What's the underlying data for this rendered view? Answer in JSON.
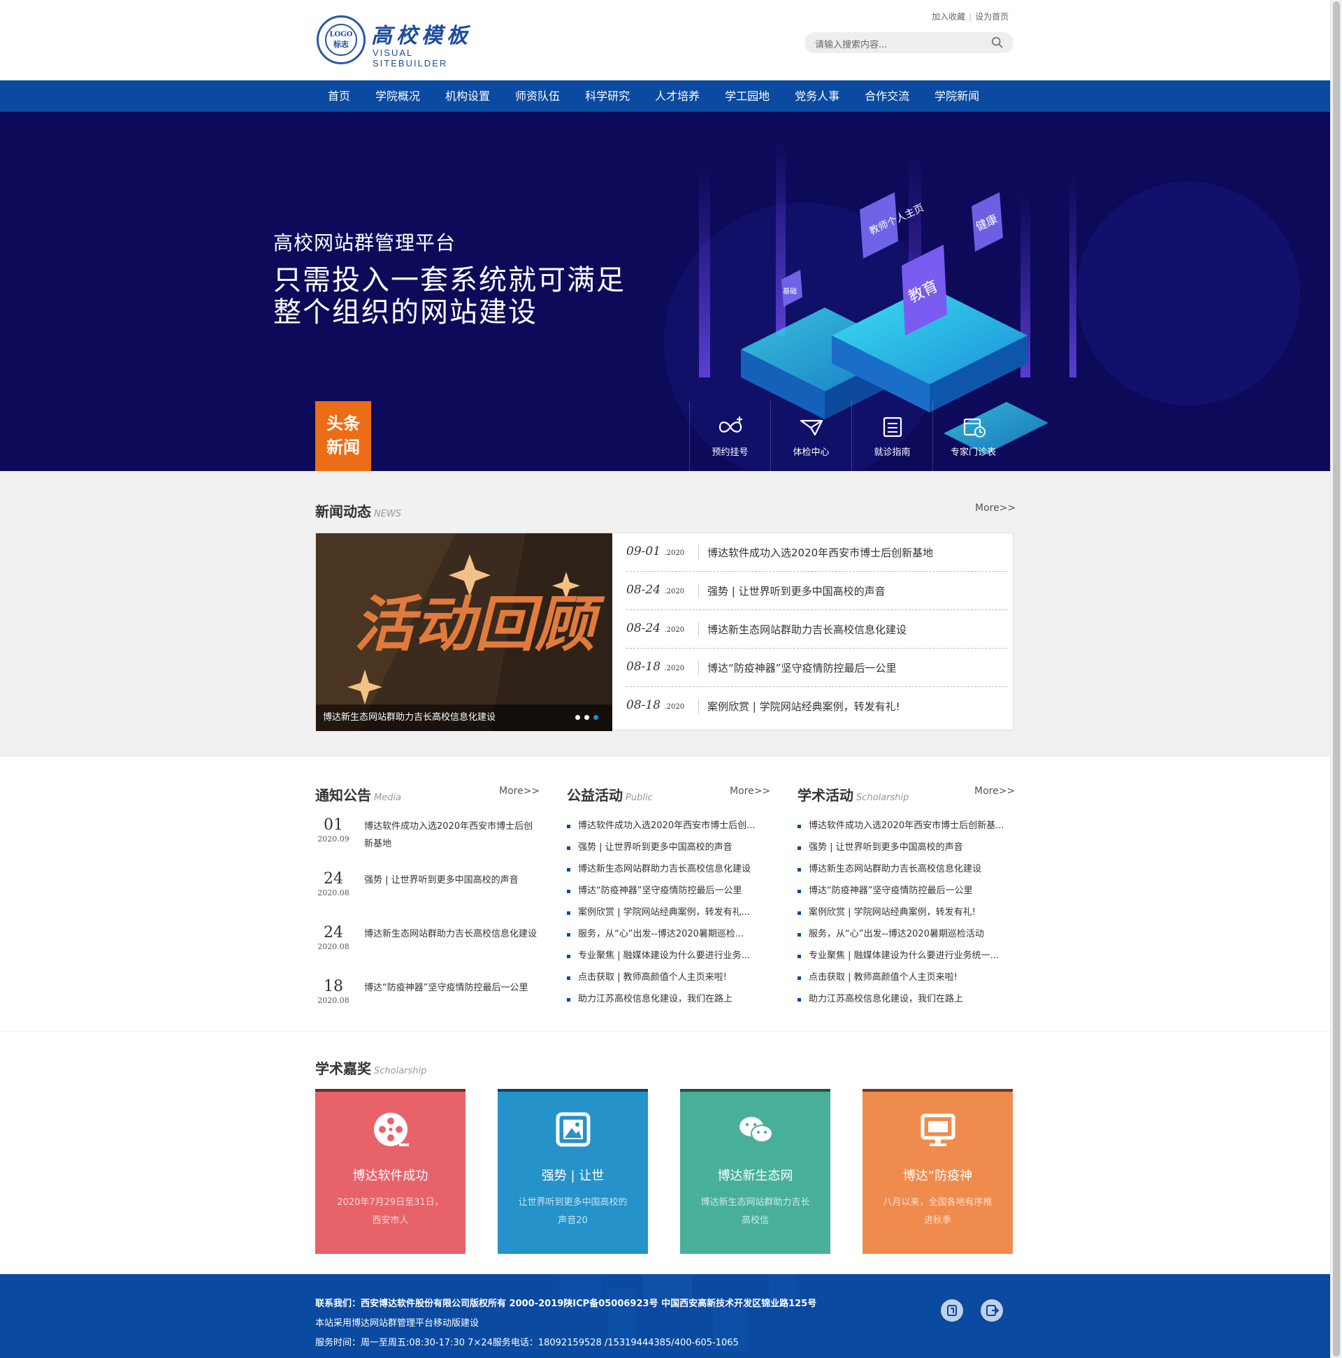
{
  "header": {
    "logo_text": "LOGO",
    "logo_sub_cn": "标志",
    "site_title": "高校模板",
    "site_subtitle": "VISUAL  SITEBUILDER",
    "toplinks": [
      "加入收藏",
      "设为首页"
    ],
    "search_placeholder": "请输入搜索内容..."
  },
  "nav": [
    "首页",
    "学院概况",
    "机构设置",
    "师资队伍",
    "科学研究",
    "人才培养",
    "学工园地",
    "党务人事",
    "合作交流",
    "学院新闻"
  ],
  "banner": {
    "title": "高校网站群管理平台",
    "headline_line1": "只需投入一套系统就可满足",
    "headline_line2": "整个组织的网站建设",
    "badge_line1": "头条",
    "badge_line2": "新闻",
    "quick_links": [
      "预约挂号",
      "体检中心",
      "就诊指南",
      "专家门诊表"
    ],
    "iso_labels": [
      "教师个人主页",
      "教育",
      "健康",
      "基础"
    ],
    "colors": {
      "bg": "#0e0a5a",
      "badge": "#ec6d15"
    }
  },
  "news": {
    "title": "新闻动态",
    "title_en": "NEWS",
    "more": "More>>",
    "image_caption": "博达新生态网站群助力吉长高校信息化建设",
    "image_text": "活动回顾",
    "items": [
      {
        "date": "09-01",
        "year": ".2020",
        "title": "博达软件成功入选2020年西安市博士后创新基地"
      },
      {
        "date": "08-24",
        "year": ".2020",
        "title": "强势 | 让世界听到更多中国高校的声音"
      },
      {
        "date": "08-24",
        "year": ".2020",
        "title": "博达新生态网站群助力吉长高校信息化建设"
      },
      {
        "date": "08-18",
        "year": ".2020",
        "title": "博达“防疫神器”坚守疫情防控最后一公里"
      },
      {
        "date": "08-18",
        "year": ".2020",
        "title": "案例欣赏 | 学院网站经典案例，转发有礼!"
      }
    ]
  },
  "notice": {
    "title": "通知公告",
    "title_en": "Media",
    "more": "More>>",
    "items": [
      {
        "day": "01",
        "ym": "2020.09",
        "title": "博达软件成功入选2020年西安市博士后创新基地"
      },
      {
        "day": "24",
        "ym": "2020.08",
        "title": "强势 | 让世界听到更多中国高校的声音"
      },
      {
        "day": "24",
        "ym": "2020.08",
        "title": "博达新生态网站群助力吉长高校信息化建设"
      },
      {
        "day": "18",
        "ym": "2020.08",
        "title": "博达“防疫神器”坚守疫情防控最后一公里"
      }
    ]
  },
  "public": {
    "title": "公益活动",
    "title_en": "Public",
    "more": "More>>",
    "items": [
      "博达软件成功入选2020年西安市博士后创...",
      "强势 | 让世界听到更多中国高校的声音",
      "博达新生态网站群助力吉长高校信息化建设",
      "博达“防疫神器”坚守疫情防控最后一公里",
      "案例欣赏 | 学院网站经典案例，转发有礼...",
      "服务，从“心”出发--博达2020暑期巡检...",
      "专业聚焦 | 融媒体建设为什么要进行业务...",
      "点击获取 | 教师高颜值个人主页来啦!",
      "助力江苏高校信息化建设，我们在路上"
    ]
  },
  "academic": {
    "title": "学术活动",
    "title_en": "Scholarship",
    "more": "More>>",
    "items": [
      "博达软件成功入选2020年西安市博士后创新基...",
      "强势 | 让世界听到更多中国高校的声音",
      "博达新生态网站群助力吉长高校信息化建设",
      "博达“防疫神器”坚守疫情防控最后一公里",
      "案例欣赏 | 学院网站经典案例，转发有礼!",
      "服务，从“心”出发--博达2020暑期巡检活动",
      "专业聚焦 | 融媒体建设为什么要进行业务统一...",
      "点击获取 | 教师高颜值个人主页来啦!",
      "助力江苏高校信息化建设，我们在路上"
    ]
  },
  "awards": {
    "title": "学术嘉奖",
    "title_en": "Scholarship",
    "cards": [
      {
        "icon": "film-reel-icon",
        "color": "#e8626a",
        "title": "博达软件成功",
        "desc": "2020年7月29日至31日，西安市人"
      },
      {
        "icon": "image-icon",
        "color": "#2592c9",
        "title": "强势 | 让世",
        "desc": "让世界听到更多中国高校的声音20"
      },
      {
        "icon": "wechat-icon",
        "color": "#48b09a",
        "title": "博达新生态网",
        "desc": "博达新生态网站群助力吉长高校信"
      },
      {
        "icon": "monitor-icon",
        "color": "#f08b4e",
        "title": "博达“防疫神",
        "desc": "八月以来，全国各地有序推进秋季"
      }
    ]
  },
  "footer": {
    "line1": "联系我们：西安博达软件股份有限公司版权所有 2000-2019陕ICP备05006923号 中国西安高新技术开发区锦业路125号",
    "line2": "本站采用博达网站群管理平台移动版建设",
    "line3": "服务时间：周一至周五:08:30-17:30 7×24服务电话：18092159528 /15319444385/400-605-1065",
    "icons": [
      "bookmark-icon",
      "exit-icon"
    ]
  }
}
